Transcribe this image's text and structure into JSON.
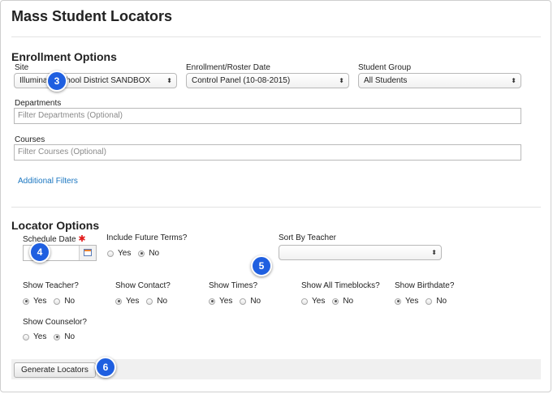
{
  "page": {
    "title": "Mass Student Locators"
  },
  "enrollment": {
    "section_title": "Enrollment Options",
    "site": {
      "label": "Site",
      "value": "Illuminate School District SANDBOX"
    },
    "roster_date": {
      "label": "Enrollment/Roster Date",
      "value": "Control Panel (10-08-2015)"
    },
    "student_group": {
      "label": "Student Group",
      "value": "All Students"
    },
    "departments": {
      "label": "Departments",
      "placeholder": "Filter Departments (Optional)"
    },
    "courses": {
      "label": "Courses",
      "placeholder": "Filter Courses (Optional)"
    },
    "additional_filters": "Additional Filters"
  },
  "locator": {
    "section_title": "Locator Options",
    "schedule_date": {
      "label": "Schedule Date",
      "required_mark": "✱",
      "value": ""
    },
    "future_terms": {
      "label": "Include Future Terms?",
      "yes": "Yes",
      "no": "No",
      "selected": "No"
    },
    "sort_by_teacher": {
      "label": "Sort By Teacher",
      "value": ""
    },
    "show_teacher": {
      "label": "Show Teacher?",
      "yes": "Yes",
      "no": "No",
      "selected": "Yes"
    },
    "show_contact": {
      "label": "Show Contact?",
      "yes": "Yes",
      "no": "No",
      "selected": "Yes"
    },
    "show_times": {
      "label": "Show Times?",
      "yes": "Yes",
      "no": "No",
      "selected": "Yes"
    },
    "show_all_timeblocks": {
      "label": "Show All Timeblocks?",
      "yes": "Yes",
      "no": "No",
      "selected": "No"
    },
    "show_birthdate": {
      "label": "Show Birthdate?",
      "yes": "Yes",
      "no": "No",
      "selected": "Yes"
    },
    "show_counselor": {
      "label": "Show Counselor?",
      "yes": "Yes",
      "no": "No",
      "selected": "No"
    }
  },
  "actions": {
    "generate_label": "Generate Locators"
  },
  "callouts": {
    "site": "3",
    "schedule_date": "4",
    "sort_by_teacher": "5",
    "generate": "6"
  },
  "colors": {
    "accent_link": "#1a76c0",
    "callout_blue": "#1f5fe0",
    "required_red": "#e21b1b"
  }
}
